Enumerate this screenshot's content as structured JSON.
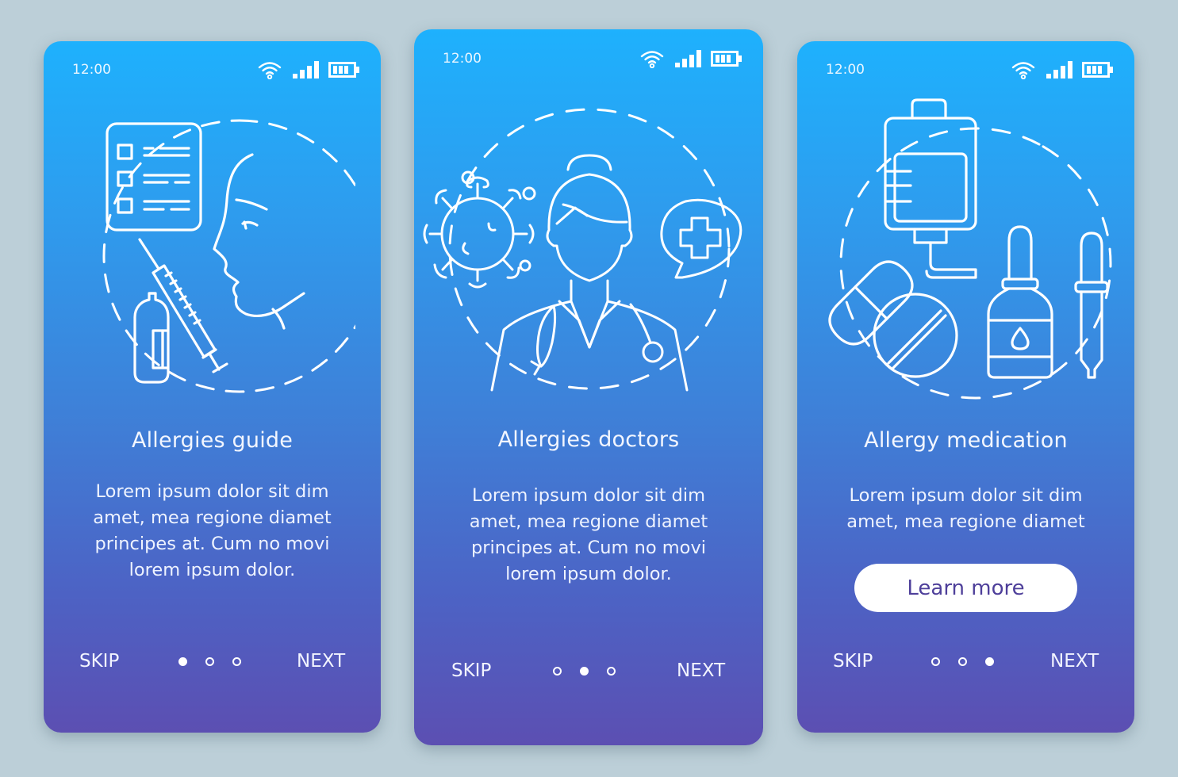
{
  "colors": {
    "background": "#bccfd8",
    "gradient_top": "#1eb1fd",
    "gradient_bottom": "#5c4fb2",
    "cta_text": "#4e3f9a"
  },
  "screens": [
    {
      "status": {
        "time": "12:00",
        "icons": [
          "wifi-icon",
          "signal-icon",
          "battery-icon"
        ]
      },
      "illustration": "allergy-test-checklist-syringe-vial-face",
      "title": "Allergies guide",
      "body_lines": [
        "Lorem ipsum dolor sit dim",
        "amet, mea regione diamet",
        "principes at. Cum no movi",
        "lorem ipsum dolor."
      ],
      "nav": {
        "skip": "SKIP",
        "next": "NEXT",
        "active_page": 1,
        "total_pages": 3
      }
    },
    {
      "status": {
        "time": "12:00",
        "icons": [
          "wifi-icon",
          "signal-icon",
          "battery-icon"
        ]
      },
      "illustration": "doctor-virus-medical-cross-bubble",
      "title": "Allergies doctors",
      "body_lines": [
        "Lorem ipsum dolor sit dim",
        "amet, mea regione diamet",
        "principes at. Cum no movi",
        "lorem ipsum dolor."
      ],
      "nav": {
        "skip": "SKIP",
        "next": "NEXT",
        "active_page": 2,
        "total_pages": 3
      }
    },
    {
      "status": {
        "time": "12:00",
        "icons": [
          "wifi-icon",
          "signal-icon",
          "battery-icon"
        ]
      },
      "illustration": "iv-bag-pills-bottle-dropper",
      "title": "Allergy medication",
      "body_lines": [
        "Lorem ipsum dolor sit dim",
        "amet, mea regione diamet"
      ],
      "cta": "Learn more",
      "nav": {
        "skip": "SKIP",
        "next": "NEXT",
        "active_page": 3,
        "total_pages": 3
      }
    }
  ]
}
